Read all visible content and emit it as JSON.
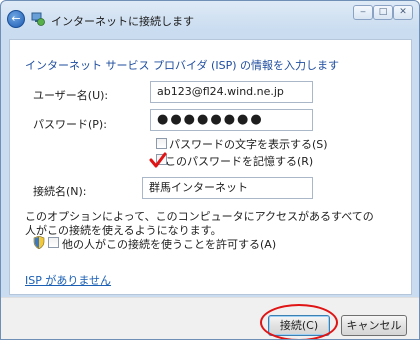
{
  "window": {
    "title": "インターネットに接続します",
    "controls": {
      "minimize": "‒",
      "maximize": "□",
      "close": "✕"
    },
    "back_glyph": "←"
  },
  "heading": "インターネット サービス プロバイダ (ISP) の情報を入力します",
  "form": {
    "username_label": "ユーザー名(U):",
    "username_value": "ab123@fl24.wind.ne.jp",
    "password_label": "パスワード(P):",
    "password_value": "●●●●●●●●",
    "show_password_label": "パスワードの文字を表示する(S)",
    "remember_password_label": "このパスワードを記憶する(R)",
    "connection_name_label": "接続名(N):",
    "connection_name_value": "群馬インターネット"
  },
  "description": "このオプションによって、このコンピュータにアクセスがあるすべての人がこの接続を使えるようになります。",
  "allow_others_label": "他の人がこの接続を使うことを許可する(A)",
  "isp_link": "ISP がありません",
  "buttons": {
    "connect": "接続(C)",
    "cancel": "キャンセル"
  },
  "colors": {
    "link": "#1a5fb4",
    "heading": "#1d4c9e",
    "annotation": "#e01414"
  }
}
